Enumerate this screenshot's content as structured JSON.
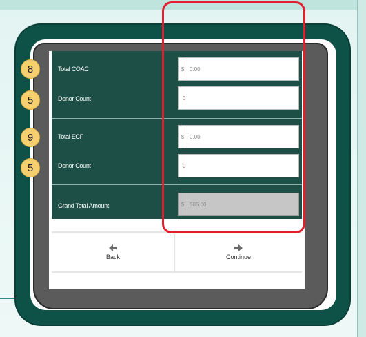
{
  "form": {
    "total_coac_label": "Total COAC",
    "total_coac_currency": "$",
    "total_coac_value": "0.00",
    "donor_count_1_label": "Donor Count",
    "donor_count_1_value": "0",
    "total_ecf_label": "Total ECF",
    "total_ecf_currency": "$",
    "total_ecf_value": "0.00",
    "donor_count_2_label": "Donor Count",
    "donor_count_2_value": "0",
    "grand_total_label": "Grand Total Amount",
    "grand_total_currency": "$",
    "grand_total_value": "505.00"
  },
  "nav": {
    "back_label": "Back",
    "continue_label": "Continue"
  },
  "callouts": [
    "8",
    "5",
    "9",
    "5"
  ],
  "colors": {
    "panel": "#1d4f47",
    "tablet_frame": "#0d5147",
    "badge": "#f6cf6e",
    "highlight": "#e0202e"
  }
}
